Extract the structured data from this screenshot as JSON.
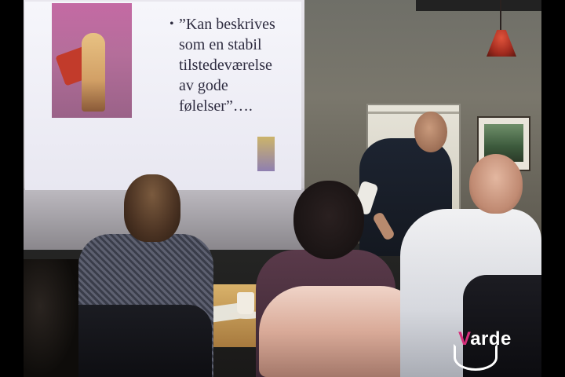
{
  "slide": {
    "bullet": "•",
    "lines": [
      "”Kan beskrives",
      "som en stabil",
      "tilstedeværelse",
      "av gode",
      "følelser”…."
    ]
  },
  "logo": {
    "first_letter": "V",
    "rest": "arde",
    "accent_color": "#d62d7a"
  },
  "colors": {
    "slide_text": "#2e2c40",
    "logo_text": "#ffffff"
  }
}
